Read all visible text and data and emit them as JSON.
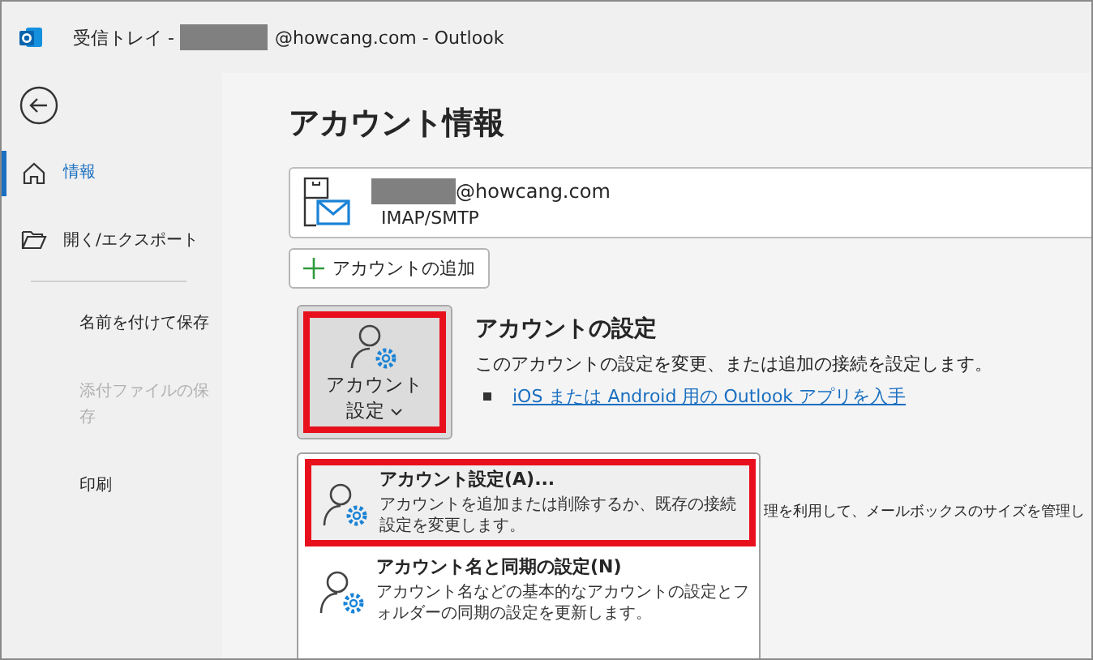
{
  "window": {
    "title_prefix": "受信トレイ -",
    "title_suffix": "@howcang.com  -  Outlook"
  },
  "sidebar": {
    "items": [
      {
        "kind": "nav",
        "label": "情報",
        "selected": true,
        "disabled": false
      },
      {
        "kind": "nav",
        "label": "開く/エクスポート",
        "selected": false,
        "disabled": false
      },
      {
        "kind": "divider"
      },
      {
        "kind": "nav",
        "label": "名前を付けて保存",
        "selected": false,
        "disabled": false
      },
      {
        "kind": "nav",
        "label": "添付ファイルの保存",
        "selected": false,
        "disabled": true
      },
      {
        "kind": "nav",
        "label": "印刷",
        "selected": false,
        "disabled": false
      }
    ]
  },
  "main": {
    "heading": "アカウント情報",
    "account": {
      "email_suffix": "@howcang.com",
      "type": "IMAP/SMTP"
    },
    "add_account_button": "アカウントの追加",
    "account_settings": {
      "button_line1": "アカウント",
      "button_line2": "設定",
      "highlighted": true,
      "title": "アカウントの設定",
      "description": "このアカウントの設定を変更、または追加の接続を設定します。",
      "link": "iOS または Android 用の Outlook アプリを入手"
    },
    "hidden_text": "理を利用して、メールボックスのサイズを管理し"
  },
  "dropdown": {
    "items": [
      {
        "title": "アカウント設定(A)...",
        "description": "アカウントを追加または削除するか、既存の接続設定を変更します。",
        "selected": true,
        "highlighted": true
      },
      {
        "title": "アカウント名と同期の設定(N)",
        "description": "アカウント名などの基本的なアカウントの設定とフォルダーの同期の設定を更新します。",
        "selected": false,
        "highlighted": false
      }
    ]
  }
}
